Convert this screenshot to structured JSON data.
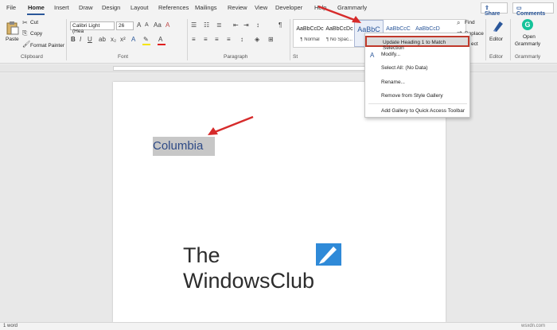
{
  "menubar": {
    "tabs": [
      "File",
      "Home",
      "Insert",
      "Draw",
      "Design",
      "Layout",
      "References",
      "Mailings",
      "Review",
      "View",
      "Developer",
      "Help",
      "Grammarly"
    ],
    "share_label": "Share",
    "comments_label": "Comments"
  },
  "ribbon": {
    "clipboard": {
      "paste": "Paste",
      "cut": "Cut",
      "copy": "Copy",
      "format_painter": "Format Painter",
      "group": "Clipboard"
    },
    "font": {
      "name": "Calibri Light (Hea",
      "size": "26",
      "group": "Font",
      "bold": "B",
      "italic": "I",
      "underline": "U"
    },
    "paragraph": {
      "group": "Paragraph",
      "pilcrow": "¶"
    },
    "styles": {
      "group": "St",
      "items": [
        {
          "sample": "AaBbCcDc",
          "name": "¶ Normal"
        },
        {
          "sample": "AaBbCcDc",
          "name": "¶ No Spac..."
        },
        {
          "sample": "AaBbC",
          "name": "Hea"
        },
        {
          "sample": "AaBbCcC",
          "name": ""
        },
        {
          "sample": "AaBbCcD",
          "name": ""
        }
      ]
    },
    "editing": {
      "find": "Find",
      "replace": "Replace",
      "select": "ect"
    },
    "editor": {
      "label": "Editor",
      "group": "Editor"
    },
    "grammarly": {
      "open": "Open",
      "name": "Grammarly",
      "group": "Grammarly"
    }
  },
  "context_menu": {
    "items": [
      "Update Heading 1 to Match Selection",
      "Modify...",
      "Select All: (No Data)",
      "Rename...",
      "Remove from Style Gallery",
      "Add Gallery to Quick Access Toolbar"
    ]
  },
  "document": {
    "heading": "Columbia",
    "logo_line1": "The",
    "logo_line2": "WindowsClub"
  },
  "status": {
    "word_count": "1 word"
  },
  "watermark": "wsxdn.com",
  "colors": {
    "accent": "#2b579a",
    "annotation_arrow": "#d62b2b",
    "heading_text": "#2e4a86"
  }
}
